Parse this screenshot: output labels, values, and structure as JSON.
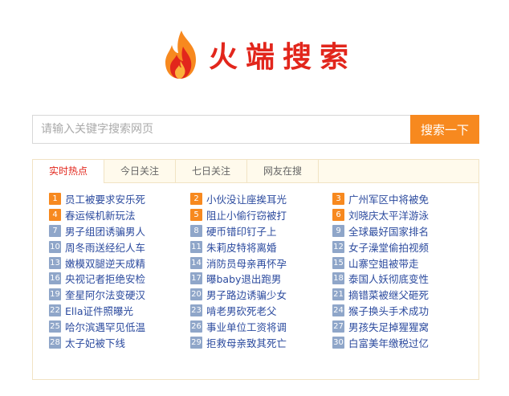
{
  "logo": {
    "text": "火端搜索",
    "flame_colors": [
      "#f7891f",
      "#e2261c",
      "#fbb03b"
    ]
  },
  "search": {
    "placeholder": "请输入关键字搜索网页",
    "value": "",
    "button_label": "搜索一下"
  },
  "tabs": [
    {
      "label": "实时热点",
      "active": true
    },
    {
      "label": "今日关注",
      "active": false
    },
    {
      "label": "七日关注",
      "active": false
    },
    {
      "label": "网友在搜",
      "active": false
    }
  ],
  "hot_items": [
    {
      "rank": "1",
      "text": "员工被要求安乐死"
    },
    {
      "rank": "2",
      "text": "小伙没让座挨耳光"
    },
    {
      "rank": "3",
      "text": "广州军区中将被免"
    },
    {
      "rank": "4",
      "text": "春运候机新玩法"
    },
    {
      "rank": "5",
      "text": "阻止小偷行窃被打"
    },
    {
      "rank": "6",
      "text": "刘晓庆太平洋游泳"
    },
    {
      "rank": "7",
      "text": "男子组团诱骗男人"
    },
    {
      "rank": "8",
      "text": "硬币错印钉子上"
    },
    {
      "rank": "9",
      "text": "全球最好国家排名"
    },
    {
      "rank": "10",
      "text": "周冬雨送经纪人车"
    },
    {
      "rank": "11",
      "text": "朱莉皮特将离婚"
    },
    {
      "rank": "12",
      "text": "女子澡堂偷拍视频"
    },
    {
      "rank": "13",
      "text": "嫩模双腿逆天成精"
    },
    {
      "rank": "14",
      "text": "消防员母亲再怀孕"
    },
    {
      "rank": "15",
      "text": "山寨空姐被带走"
    },
    {
      "rank": "16",
      "text": "央视记者拒绝安检"
    },
    {
      "rank": "17",
      "text": "曝baby退出跑男"
    },
    {
      "rank": "18",
      "text": "泰国人妖彻底变性"
    },
    {
      "rank": "19",
      "text": "奎星阿尔法变硬汉"
    },
    {
      "rank": "20",
      "text": "男子路边诱骗少女"
    },
    {
      "rank": "21",
      "text": "摘错菜被继父砸死"
    },
    {
      "rank": "22",
      "text": "Ella证件照曝光"
    },
    {
      "rank": "23",
      "text": "啃老男砍死老父"
    },
    {
      "rank": "24",
      "text": "猴子换头手术成功"
    },
    {
      "rank": "25",
      "text": "哈尔滨遇罕见低温"
    },
    {
      "rank": "26",
      "text": "事业单位工资将调"
    },
    {
      "rank": "27",
      "text": "男孩失足掉猩猩窝"
    },
    {
      "rank": "28",
      "text": "太子妃被下线"
    },
    {
      "rank": "29",
      "text": "拒救母亲致其死亡"
    },
    {
      "rank": "30",
      "text": "白富美年缴税过亿"
    }
  ],
  "colors": {
    "accent": "#f7891f",
    "logo_text": "#e2261c",
    "link": "#2b4a9e",
    "rank_default": "#8fa6c9"
  }
}
